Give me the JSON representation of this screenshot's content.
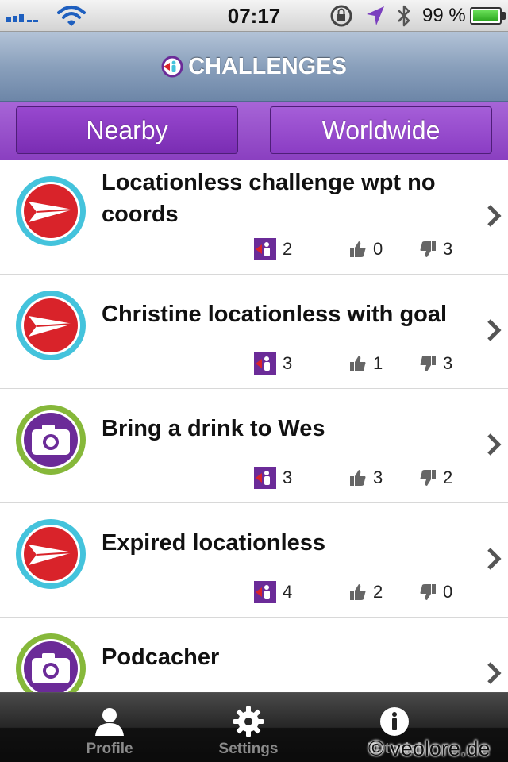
{
  "status_bar": {
    "time": "07:17",
    "battery_percent": "99 %",
    "icons": [
      "signal-icon",
      "wifi-icon",
      "rotation-lock-icon",
      "location-arrow-icon",
      "bluetooth-icon",
      "battery-icon"
    ],
    "battery_level": 0.99
  },
  "nav": {
    "title": "CHALLENGES",
    "logo_icon": "challenges-logo-icon"
  },
  "segments": {
    "nearby": "Nearby",
    "worldwide": "Worldwide",
    "selected": "Worldwide"
  },
  "challenges": [
    {
      "title": "Locationless challenge wpt no coords",
      "type_icon": "paper-plane-icon",
      "completions": "2",
      "likes": "0",
      "dislikes": "3"
    },
    {
      "title": "Christine locationless with goal",
      "type_icon": "paper-plane-icon",
      "completions": "3",
      "likes": "1",
      "dislikes": "3"
    },
    {
      "title": "Bring a drink to Wes",
      "type_icon": "camera-icon",
      "completions": "3",
      "likes": "3",
      "dislikes": "2"
    },
    {
      "title": "Expired locationless",
      "type_icon": "paper-plane-icon",
      "completions": "4",
      "likes": "2",
      "dislikes": "0"
    },
    {
      "title": "Podcacher",
      "type_icon": "camera-icon",
      "completions": "",
      "likes": "",
      "dislikes": ""
    }
  ],
  "tabs": [
    {
      "label": "Profile",
      "icon": "person-icon"
    },
    {
      "label": "Settings",
      "icon": "gear-icon"
    },
    {
      "label": "Tutorial",
      "icon": "info-icon"
    }
  ],
  "watermark": "© veolore.de",
  "colors": {
    "accent_purple": "#8a3fc0",
    "nav_blue": "#7f95b3",
    "plane_red": "#d9232a",
    "plane_ring": "#44c3dc",
    "camera_purple": "#6b2b98",
    "camera_ring": "#86b83a"
  }
}
